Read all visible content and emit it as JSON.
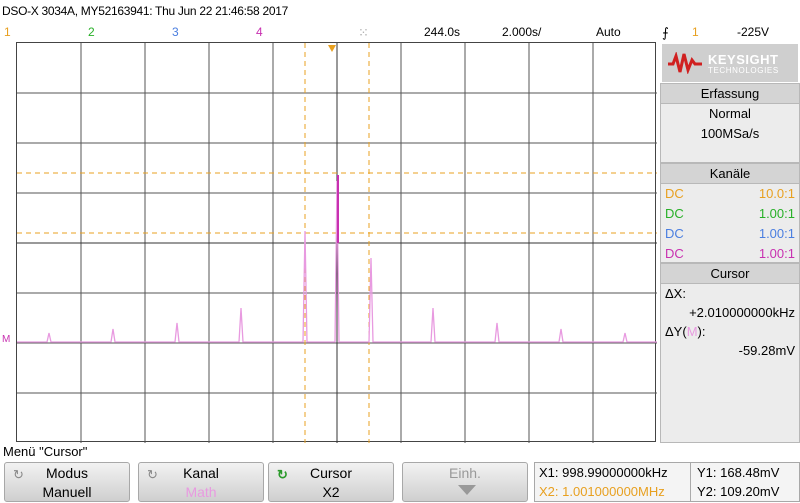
{
  "header": {
    "title": "DSO-X 3034A, MY52163941: Thu Jun 22 21:46:58 2017"
  },
  "channels_row": {
    "ch1": "1",
    "ch2": "2",
    "ch3": "3",
    "ch4": "4",
    "time_position": "244.0s",
    "time_div": "2.000s/",
    "trigger_mode": "Auto",
    "trigger_channel": "1",
    "trigger_level": "-225V"
  },
  "logo": {
    "brand": "KEYSIGHT",
    "sub": "TECHNOLOGIES"
  },
  "acquisition": {
    "header": "Erfassung",
    "mode": "Normal",
    "rate": "100MSa/s"
  },
  "channels": {
    "header": "Kanäle",
    "rows": [
      {
        "coupling": "DC",
        "probe": "10.0:1",
        "color": "#e8a020"
      },
      {
        "coupling": "DC",
        "probe": "1.00:1",
        "color": "#28b028"
      },
      {
        "coupling": "DC",
        "probe": "1.00:1",
        "color": "#4a7ee0"
      },
      {
        "coupling": "DC",
        "probe": "1.00:1",
        "color": "#c830b0"
      }
    ]
  },
  "cursor_panel": {
    "header": "Cursor",
    "dx_label": "ΔX:",
    "dx_value": "+2.010000000kHz",
    "dy_label_prefix": "ΔY(",
    "dy_label_ch": "M",
    "dy_label_suffix": "):",
    "dy_value": "-59.28mV"
  },
  "menu": {
    "label": "Menü \"Cursor\"",
    "softkeys": [
      {
        "title": "Modus",
        "value": "Manuell"
      },
      {
        "title": "Kanal",
        "value": "Math"
      },
      {
        "title": "Cursor",
        "value": "X2"
      },
      {
        "title": "Einh.",
        "value": ""
      }
    ]
  },
  "readout": {
    "x1": "X1: 998.99000000kHz",
    "x2": "X2: 1.001000000MHz",
    "y1": "Y1: 168.48mV",
    "y2": "Y2: 109.20mV"
  },
  "graticule_marker": "M",
  "colors": {
    "ch1": "#e8a020",
    "ch2": "#28b028",
    "ch3": "#4a7ee0",
    "math": "#c830b0",
    "math_trace": "#e89ae0",
    "cursor": "#e8a020"
  }
}
